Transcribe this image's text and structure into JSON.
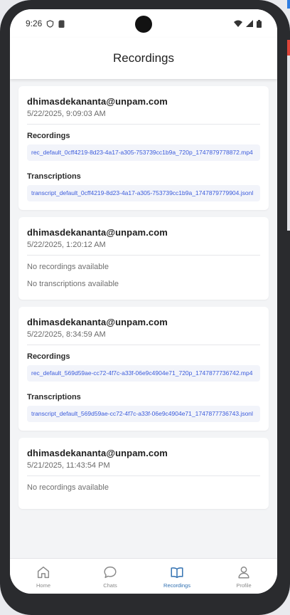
{
  "status_bar": {
    "time": "9:26",
    "left_icons": [
      "shield-icon",
      "sim-card-icon"
    ],
    "right_icons": [
      "wifi-icon",
      "signal-icon",
      "battery-icon"
    ]
  },
  "header": {
    "title": "Recordings"
  },
  "cards": [
    {
      "email": "dhimasdekananta@unpam.com",
      "date": "5/22/2025, 9:09:03 AM",
      "recordings_label": "Recordings",
      "recording_file": "rec_default_0cff4219-8d23-4a17-a305-753739cc1b9a_720p_1747879778872.mp4",
      "transcriptions_label": "Transcriptions",
      "transcript_file": "transcript_default_0cff4219-8d23-4a17-a305-753739cc1b9a_1747879779904.jsonl"
    },
    {
      "email": "dhimasdekananta@unpam.com",
      "date": "5/22/2025, 1:20:12 AM",
      "no_recordings": "No recordings available",
      "no_transcriptions": "No transcriptions available"
    },
    {
      "email": "dhimasdekananta@unpam.com",
      "date": "5/22/2025, 8:34:59 AM",
      "recordings_label": "Recordings",
      "recording_file": "rec_default_569d59ae-cc72-4f7c-a33f-06e9c4904e71_720p_1747877736742.mp4",
      "transcriptions_label": "Transcriptions",
      "transcript_file": "transcript_default_569d59ae-cc72-4f7c-a33f-06e9c4904e71_1747877736743.jsonl"
    },
    {
      "email": "dhimasdekananta@unpam.com",
      "date": "5/21/2025, 11:43:54 PM",
      "no_recordings": "No recordings available"
    }
  ],
  "bottom_nav": {
    "active": "Recordings",
    "active_color": "#2f6fb0",
    "items": [
      {
        "label": "Home",
        "icon": "home-icon"
      },
      {
        "label": "Chats",
        "icon": "chat-bubble-icon"
      },
      {
        "label": "Recordings",
        "icon": "book-open-icon"
      },
      {
        "label": "Profile",
        "icon": "person-icon"
      }
    ]
  }
}
